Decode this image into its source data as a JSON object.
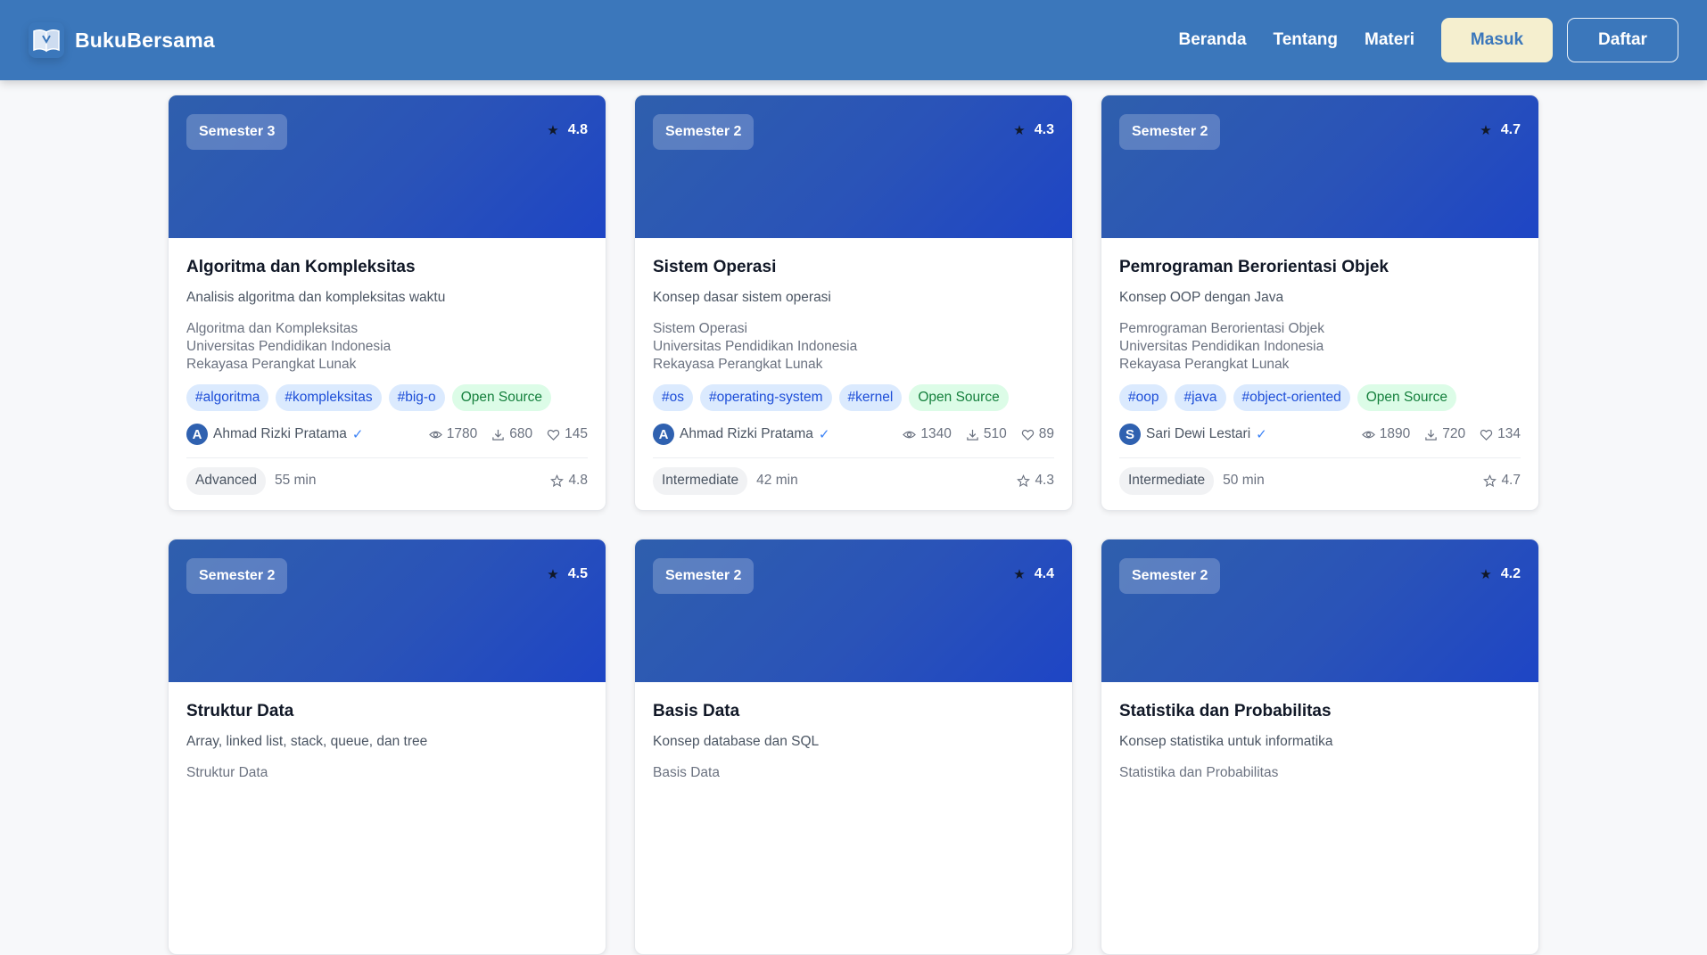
{
  "nav": {
    "brand": "BukuBersama",
    "links": [
      "Beranda",
      "Tentang",
      "Materi"
    ],
    "login_label": "Masuk",
    "register_label": "Daftar"
  },
  "colors": {
    "navbar": "#3b77bb",
    "card_header": "#2a53b8",
    "tag_bg": "#dbeafe",
    "tag_text": "#1d4ed8",
    "open_source_bg": "#dcfce7",
    "open_source_text": "#15803d",
    "login_bg": "#f5efcf"
  },
  "cards": [
    {
      "semester": "Semester 3",
      "rating": "4.8",
      "title": "Algoritma dan Kompleksitas",
      "description": "Analisis algoritma dan kompleksitas waktu",
      "course": "Algoritma dan Kompleksitas",
      "university": "Universitas Pendidikan Indonesia",
      "program": "Rekayasa Perangkat Lunak",
      "tags": [
        "#algoritma",
        "#kompleksitas",
        "#big-o"
      ],
      "open_source": "Open Source",
      "author_initial": "A",
      "author": "Ahmad Rizki Pratama",
      "verified": "✓",
      "views": "1780",
      "downloads": "680",
      "likes": "145",
      "level": "Advanced",
      "duration": "55 min"
    },
    {
      "semester": "Semester 2",
      "rating": "4.3",
      "title": "Sistem Operasi",
      "description": "Konsep dasar sistem operasi",
      "course": "Sistem Operasi",
      "university": "Universitas Pendidikan Indonesia",
      "program": "Rekayasa Perangkat Lunak",
      "tags": [
        "#os",
        "#operating-system",
        "#kernel"
      ],
      "open_source": "Open Source",
      "author_initial": "A",
      "author": "Ahmad Rizki Pratama",
      "verified": "✓",
      "views": "1340",
      "downloads": "510",
      "likes": "89",
      "level": "Intermediate",
      "duration": "42 min"
    },
    {
      "semester": "Semester 2",
      "rating": "4.7",
      "title": "Pemrograman Berorientasi Objek",
      "description": "Konsep OOP dengan Java",
      "course": "Pemrograman Berorientasi Objek",
      "university": "Universitas Pendidikan Indonesia",
      "program": "Rekayasa Perangkat Lunak",
      "tags": [
        "#oop",
        "#java",
        "#object-oriented"
      ],
      "open_source": "Open Source",
      "author_initial": "S",
      "author": "Sari Dewi Lestari",
      "verified": "✓",
      "views": "1890",
      "downloads": "720",
      "likes": "134",
      "level": "Intermediate",
      "duration": "50 min"
    },
    {
      "semester": "Semester 2",
      "rating": "4.5",
      "title": "Struktur Data",
      "description": "Array, linked list, stack, queue, dan tree",
      "course": "Struktur Data",
      "university": "",
      "program": "",
      "tags": [],
      "open_source": "",
      "author_initial": "",
      "author": "",
      "verified": "",
      "views": "",
      "downloads": "",
      "likes": "",
      "level": "",
      "duration": ""
    },
    {
      "semester": "Semester 2",
      "rating": "4.4",
      "title": "Basis Data",
      "description": "Konsep database dan SQL",
      "course": "Basis Data",
      "university": "",
      "program": "",
      "tags": [],
      "open_source": "",
      "author_initial": "",
      "author": "",
      "verified": "",
      "views": "",
      "downloads": "",
      "likes": "",
      "level": "",
      "duration": ""
    },
    {
      "semester": "Semester 2",
      "rating": "4.2",
      "title": "Statistika dan Probabilitas",
      "description": "Konsep statistika untuk informatika",
      "course": "Statistika dan Probabilitas",
      "university": "",
      "program": "",
      "tags": [],
      "open_source": "",
      "author_initial": "",
      "author": "",
      "verified": "",
      "views": "",
      "downloads": "",
      "likes": "",
      "level": "",
      "duration": ""
    }
  ]
}
